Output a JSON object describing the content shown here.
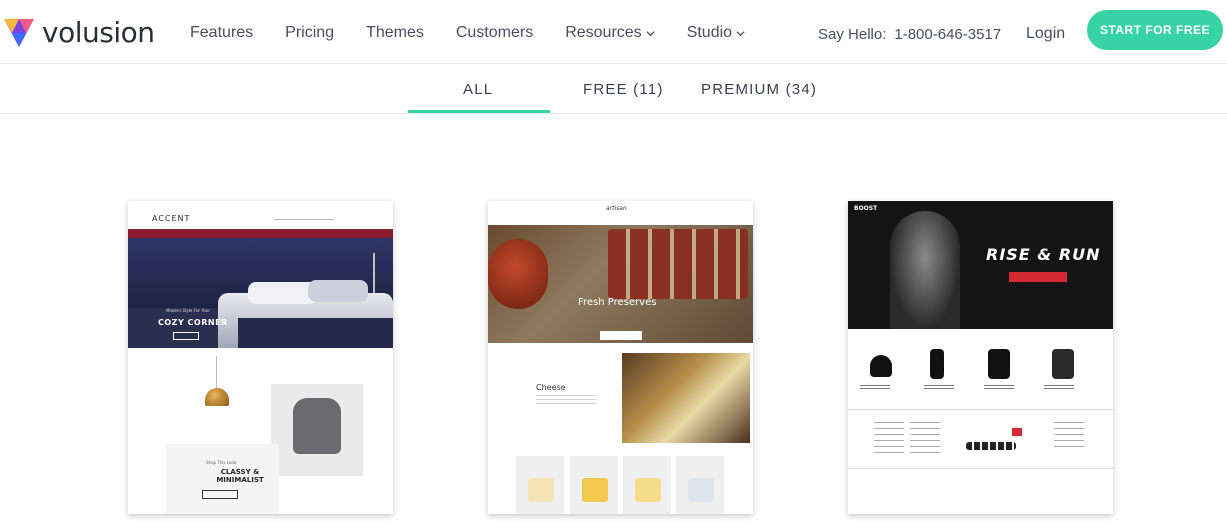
{
  "header": {
    "logo_text": "volusion",
    "nav": [
      {
        "label": "Features",
        "dropdown": false
      },
      {
        "label": "Pricing",
        "dropdown": false
      },
      {
        "label": "Themes",
        "dropdown": false
      },
      {
        "label": "Customers",
        "dropdown": false
      },
      {
        "label": "Resources",
        "dropdown": true
      },
      {
        "label": "Studio",
        "dropdown": true
      }
    ],
    "say_hello_label": "Say Hello:",
    "phone": "1-800-646-3517",
    "login_label": "Login",
    "cta_label": "START FOR FREE"
  },
  "tabs": [
    {
      "label": "ALL",
      "active": true
    },
    {
      "label": "FREE (11)",
      "active": false
    },
    {
      "label": "PREMIUM (34)",
      "active": false
    }
  ],
  "themes": {
    "accent": {
      "logo": "ACCENT",
      "hero_subtitle": "Modern Style For Your",
      "hero_title": "COZY CORNER",
      "promo_subtitle": "Shop This Look",
      "promo_title": "CLASSY & MINIMALIST"
    },
    "artisan": {
      "logo": "artisan",
      "hero_title": "Fresh Preserves",
      "feature_title": "Cheese"
    },
    "boost": {
      "logo": "BOOST",
      "hero_title": "RISE & RUN"
    }
  },
  "colors": {
    "accent": "#37d3a5",
    "text": "#4a4f5c",
    "accent_theme_nav": "#8b1d33",
    "boost_red": "#d42a34"
  }
}
